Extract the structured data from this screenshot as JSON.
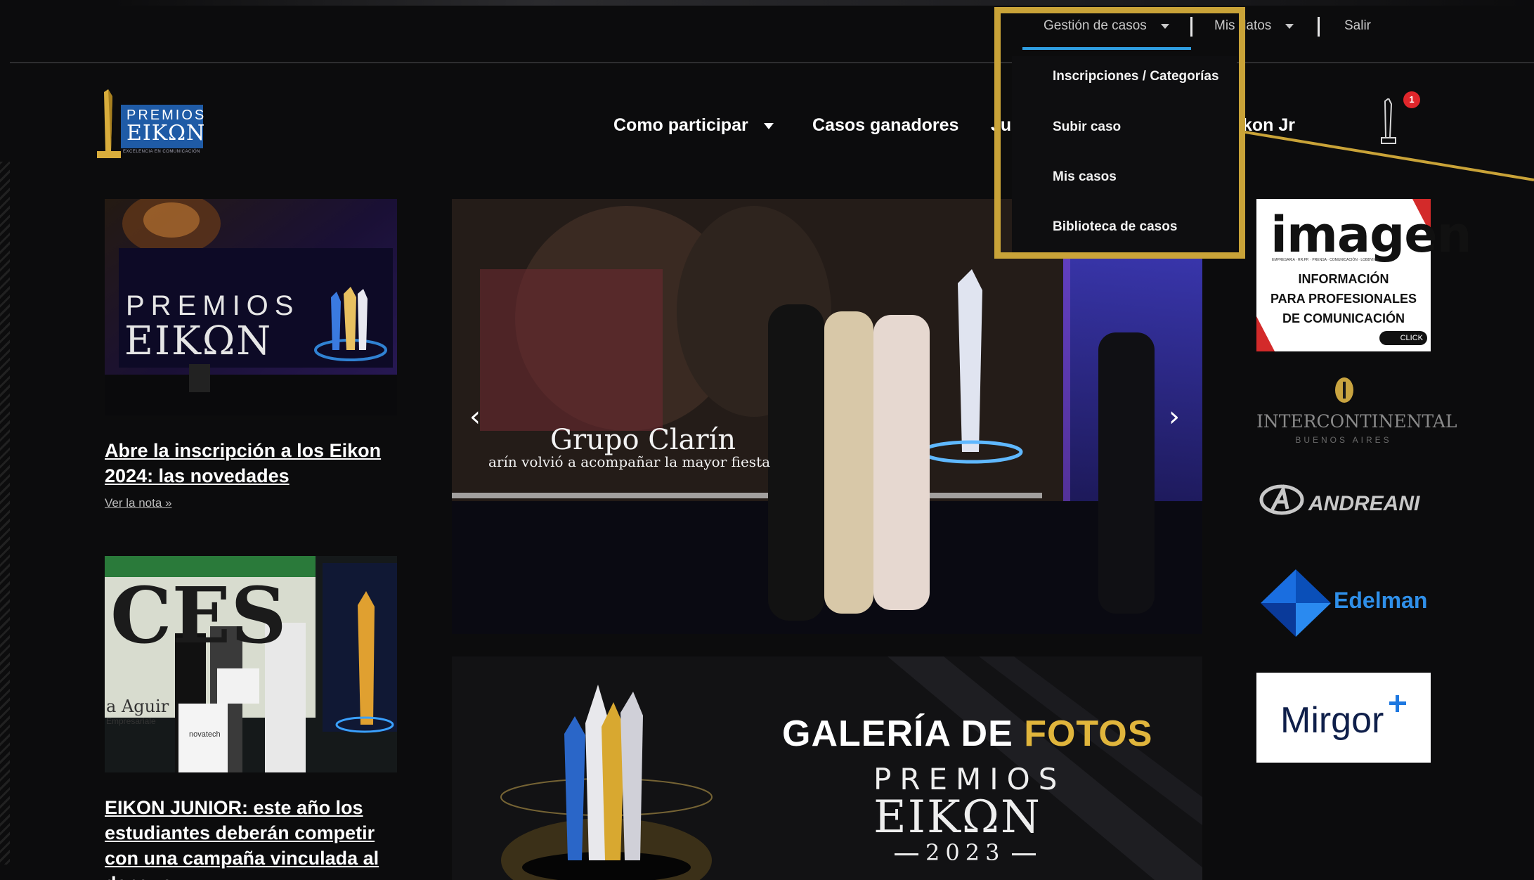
{
  "topbar": {
    "case_management": "Gestión de casos",
    "my_data": "Mis datos",
    "logout": "Salir"
  },
  "dropdown": {
    "items": [
      "Inscripciones / Categorías",
      "Subir caso",
      "Mis casos",
      "Biblioteca de casos"
    ]
  },
  "logo": {
    "line1": "PREMIOS",
    "line2": "EIKΩN",
    "tagline": "EXCELENCIA EN COMUNICACIÓN"
  },
  "nav": {
    "participate": "Como participar",
    "winners": "Casos ganadores",
    "jury_partial": "Jura",
    "eikon_jr_partial": "kon Jr"
  },
  "cart": {
    "count": "1"
  },
  "news": [
    {
      "title": "Abre la inscripción a los Eikon 2024: las novedades",
      "more": "Ver la nota »",
      "image": {
        "line1": "PREMIOS",
        "line2": "EIKΩN"
      }
    },
    {
      "title": "EIKON JUNIOR: este año los estudiantes deberán competir con una campaña vinculada al dengue",
      "image": {
        "banner": "CES",
        "caption1": "a Aguir",
        "caption2": "Empresariale",
        "bag": "novatech"
      }
    }
  ],
  "carousel": {
    "slide_title": "Grupo Clarín",
    "slide_caption": "arín volvió a acompañar la mayor fiesta"
  },
  "gallery": {
    "title_white": "GALERÍA DE",
    "title_gold": "FOTOS",
    "premios": "PREMIOS",
    "eikon": "EIKΩN",
    "year": "2023"
  },
  "sponsors": {
    "imagen": {
      "name": "imagen",
      "small": "EMPRESARIA · RR.PP. · PRENSA · COMUNICACIÓN · LOBBYING",
      "l1": "INFORMACIÓN",
      "l2": "PARA PROFESIONALES",
      "l3": "DE COMUNICACIÓN",
      "click": "CLICK"
    },
    "intercontinental": {
      "name": "INTERCONTINENTAL",
      "city": "BUENOS AIRES"
    },
    "andreani": {
      "name": "ANDREANI"
    },
    "edelman": {
      "name": "Edelman"
    },
    "mirgor": {
      "name": "Mirgor"
    }
  },
  "colors": {
    "accent_blue": "#2f9ee0",
    "highlight_gold": "#c9a338",
    "badge_red": "#e0262b",
    "gallery_gold": "#e0b53c"
  }
}
